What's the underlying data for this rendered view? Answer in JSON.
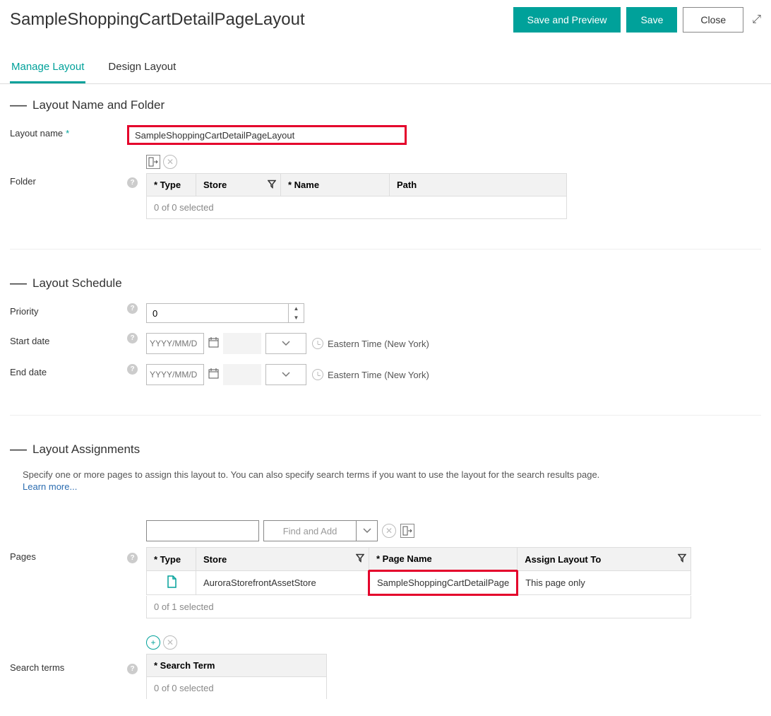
{
  "header": {
    "title": "SampleShoppingCartDetailPageLayout",
    "buttons": {
      "save_preview": "Save and Preview",
      "save": "Save",
      "close": "Close"
    }
  },
  "tabs": {
    "manage": "Manage Layout",
    "design": "Design Layout"
  },
  "section_name_folder": {
    "title": "Layout Name and Folder",
    "layout_name_label": "Layout name",
    "layout_name_value": "SampleShoppingCartDetailPageLayout",
    "folder_label": "Folder",
    "folder_table": {
      "col_type": "* Type",
      "col_store": "Store",
      "col_name": "* Name",
      "col_path": "Path",
      "status": "0 of 0 selected"
    }
  },
  "section_schedule": {
    "title": "Layout Schedule",
    "priority_label": "Priority",
    "priority_value": "0",
    "start_date_label": "Start date",
    "end_date_label": "End date",
    "date_placeholder": "YYYY/MM/D",
    "timezone": "Eastern Time (New York)"
  },
  "section_assignments": {
    "title": "Layout Assignments",
    "description": "Specify one or more pages to assign this layout to. You can also specify search terms if you want to use the layout for the search results page.",
    "learn_more": "Learn more...",
    "pages_label": "Pages",
    "find_add": "Find and Add",
    "pages_table": {
      "col_type": "* Type",
      "col_store": "Store",
      "col_page_name": "* Page Name",
      "col_assign": "Assign Layout To",
      "row1": {
        "store": "AuroraStorefrontAssetStore",
        "page_name": "SampleShoppingCartDetailPage",
        "assign": "This page only"
      },
      "status": "0 of 1 selected"
    },
    "search_terms_label": "Search terms",
    "search_terms_table": {
      "col_term": "* Search Term",
      "status": "0 of 0 selected"
    }
  }
}
